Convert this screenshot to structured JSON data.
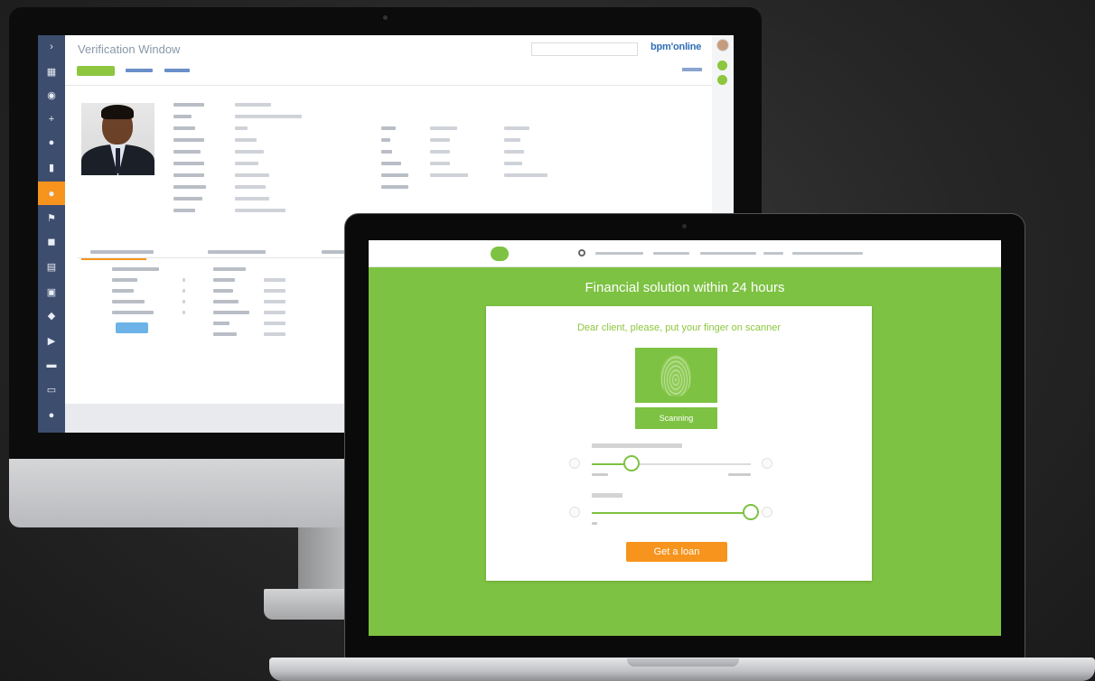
{
  "desktop": {
    "app_title": "Verification Window",
    "logo": "bpm'online",
    "sidebar_icons": [
      "chevron-right-icon",
      "grid-icon",
      "play-icon",
      "plus-icon",
      "person-icon",
      "building-icon",
      "person-icon",
      "flag-icon",
      "briefcase-icon",
      "document-icon",
      "calendar-icon",
      "chat-icon",
      "tag-icon",
      "folder-icon",
      "book-icon",
      "person-icon"
    ],
    "active_sidebar_index": 6
  },
  "laptop": {
    "hero": "Financial solution within 24 hours",
    "card_title": "Dear client, please, put your finger on scanner",
    "scanning_label": "Scanning",
    "amount_slider": {
      "value": 0.25
    },
    "term_slider": {
      "value": 1.0
    },
    "cta_label": "Get a loan"
  },
  "colors": {
    "brand_green": "#7dc242",
    "cta_orange": "#f7941d",
    "crm_sidebar": "#3d4d6e"
  }
}
